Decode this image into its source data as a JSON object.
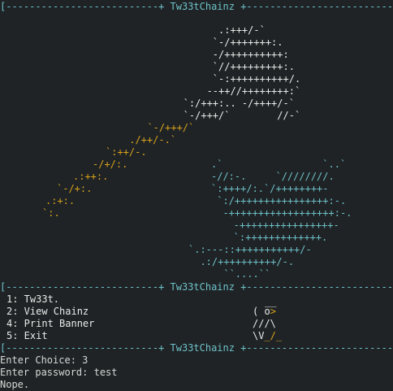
{
  "window": {
    "header_banner": "[--------------------------+ Tw33tChainz +--------------------------]",
    "menu_banner": "[--------------------------+ Tw33tChainz +--------------------------]",
    "footer_banner": "[--------------------------+ Tw33tChainz +--------------------------]"
  },
  "art": {
    "white_lines": [
      "         .:+++/-`",
      "        `-/+++++++:.",
      "        -/++++++++++:",
      "        `//+++++++++:.",
      "        `-:++++++++++/.",
      "       --++//++++++++:`",
      "   `:/+++:.. -/++++/-`",
      "   `-/+++/`        //-`"
    ],
    "gold_lines": [
      "  `-/+++/`",
      " ./++/-.`",
      "`:++/-.",
      "-/+/:.",
      ".:++:.",
      "`-/+:.",
      ".:+:.",
      "`:."
    ],
    "cyan_lines": [
      ".`                 `..`",
      "-//:-.     `////////.",
      "`:++++/:.`/++++++++-",
      " `:/++++++++++++++++:-.",
      "  -++++++++++++++++++:-.",
      "   -++++++++++++++++-",
      "   `:+++++++++++++.",
      "`.:---::+++++++++++/-",
      "  .:/++++++++++/-.",
      "      ``....``"
    ]
  },
  "menu": {
    "items": [
      "1: Tw33t.",
      "2: View Chainz",
      "4: Print Banner",
      "5: Exit"
    ],
    "ascii_bird": [
      "__",
      "( o>",
      "///\\",
      "\\V_/_"
    ]
  },
  "console": {
    "prompt_choice": "Enter Choice: 3",
    "prompt_password": "Enter password: test",
    "response": "Nope."
  },
  "colors": {
    "background": "#1f2326",
    "cyan": "#6ec2c8",
    "gold": "#d9a21b",
    "text": "#d6d8d4"
  }
}
